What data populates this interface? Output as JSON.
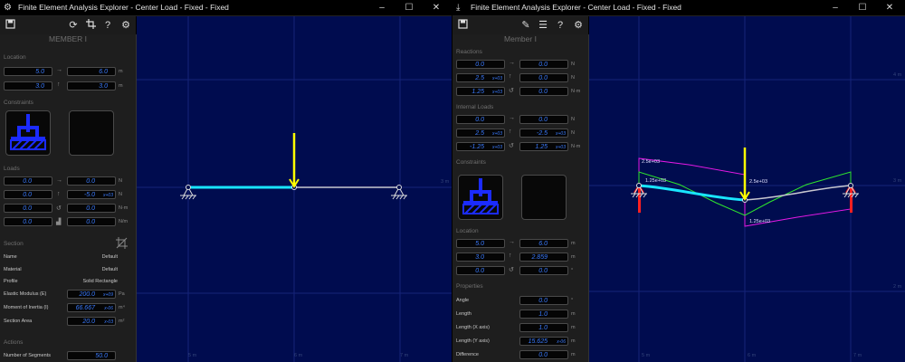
{
  "left": {
    "title": "Finite Element Analysis Explorer - Center Load - Fixed - Fixed",
    "member_header": "MEMBER I",
    "location": {
      "section": "Location",
      "start_x": "5.0",
      "end_x": "6.0",
      "start_y": "3.0",
      "end_y": "3.0",
      "unit": "m"
    },
    "constraints_section": "Constraints",
    "loads": {
      "section": "Loads",
      "rows": [
        {
          "a": "0.0",
          "a_exp": "",
          "b": "0.0",
          "b_exp": "",
          "unit": "N"
        },
        {
          "a": "0.0",
          "a_exp": "",
          "b": "-5.0",
          "b_exp": "x+03",
          "unit": "N"
        },
        {
          "a": "0.0",
          "a_exp": "",
          "b": "0.0",
          "b_exp": "",
          "unit": "N·m"
        },
        {
          "a": "0.0",
          "a_exp": "",
          "b": "0.0",
          "b_exp": "",
          "unit": "N/m"
        }
      ]
    },
    "section": {
      "title": "Section",
      "name_label": "Name",
      "name_value": "Default",
      "material_label": "Material",
      "material_value": "Default",
      "profile_label": "Profile",
      "profile_value": "Solid Rectangle",
      "emod_label": "Elastic Modulus (E)",
      "emod_value": "200.0",
      "emod_exp": "x+09",
      "emod_unit": "Pa",
      "inertia_label": "Moment of Inertia (I)",
      "inertia_value": "66.667",
      "inertia_exp": "x-06",
      "inertia_unit": "m⁴",
      "area_label": "Section Area",
      "area_value": "20.0",
      "area_exp": "x-03",
      "area_unit": "m²"
    },
    "actions": {
      "section": "Actions",
      "segments_label": "Number of Segments",
      "segments_value": "50.0"
    },
    "axis": {
      "y_label": "3 m",
      "x_labels": [
        "5 m",
        "6 m",
        "7 m"
      ]
    }
  },
  "right": {
    "title": "Finite Element Analysis Explorer - Center Load - Fixed - Fixed",
    "member_header": "Member I",
    "reactions": {
      "section": "Reactions",
      "rows": [
        {
          "a": "0.0",
          "a_exp": "",
          "b": "0.0",
          "b_exp": "",
          "unit": "N"
        },
        {
          "a": "2.5",
          "a_exp": "x+03",
          "b": "0.0",
          "b_exp": "",
          "unit": "N"
        },
        {
          "a": "1.25",
          "a_exp": "x+03",
          "b": "0.0",
          "b_exp": "",
          "unit": "N·m"
        }
      ]
    },
    "internal": {
      "section": "Internal Loads",
      "rows": [
        {
          "a": "0.0",
          "a_exp": "",
          "b": "0.0",
          "b_exp": "",
          "unit": "N"
        },
        {
          "a": "2.5",
          "a_exp": "x+03",
          "b": "-2.5",
          "b_exp": "x+03",
          "unit": "N"
        },
        {
          "a": "-1.25",
          "a_exp": "x+03",
          "b": "1.25",
          "b_exp": "x+03",
          "unit": "N·m"
        }
      ]
    },
    "constraints_section": "Constraints",
    "location": {
      "section": "Location",
      "rows": [
        {
          "a": "5.0",
          "b": "6.0",
          "unit": "m"
        },
        {
          "a": "3.0",
          "b": "2.859",
          "unit": "m"
        },
        {
          "a": "0.0",
          "b": "0.0",
          "unit": "°"
        }
      ]
    },
    "properties": {
      "section": "Properties",
      "rows": [
        {
          "label": "Angle",
          "value": "0.0",
          "exp": "",
          "unit": "°"
        },
        {
          "label": "Length",
          "value": "1.0",
          "exp": "",
          "unit": "m"
        },
        {
          "label": "Length (X axis)",
          "value": "1.0",
          "exp": "",
          "unit": "m"
        },
        {
          "label": "Length (Y axis)",
          "value": "15.625",
          "exp": "x-06",
          "unit": "m"
        },
        {
          "label": "Difference",
          "value": "0.0",
          "exp": "",
          "unit": "m"
        }
      ]
    },
    "diagram_labels": {
      "top": "2.5e+03",
      "mid_left": "1.25e+03",
      "mid_right": "2.5e+03",
      "bottom": "1.25e+03"
    },
    "axis": {
      "y_labels": [
        "4 m",
        "3 m",
        "2 m"
      ],
      "x_labels": [
        "5 m",
        "6 m",
        "7 m"
      ]
    }
  },
  "colors": {
    "canvas_bg": "#000c4f",
    "accent_blue": "#3a7bff",
    "beam_cyan": "#19e6ff",
    "load_yellow": "#ffff00",
    "shear_magenta": "#e619e6",
    "moment_green": "#2ee62e",
    "reaction_red": "#ff2020"
  }
}
